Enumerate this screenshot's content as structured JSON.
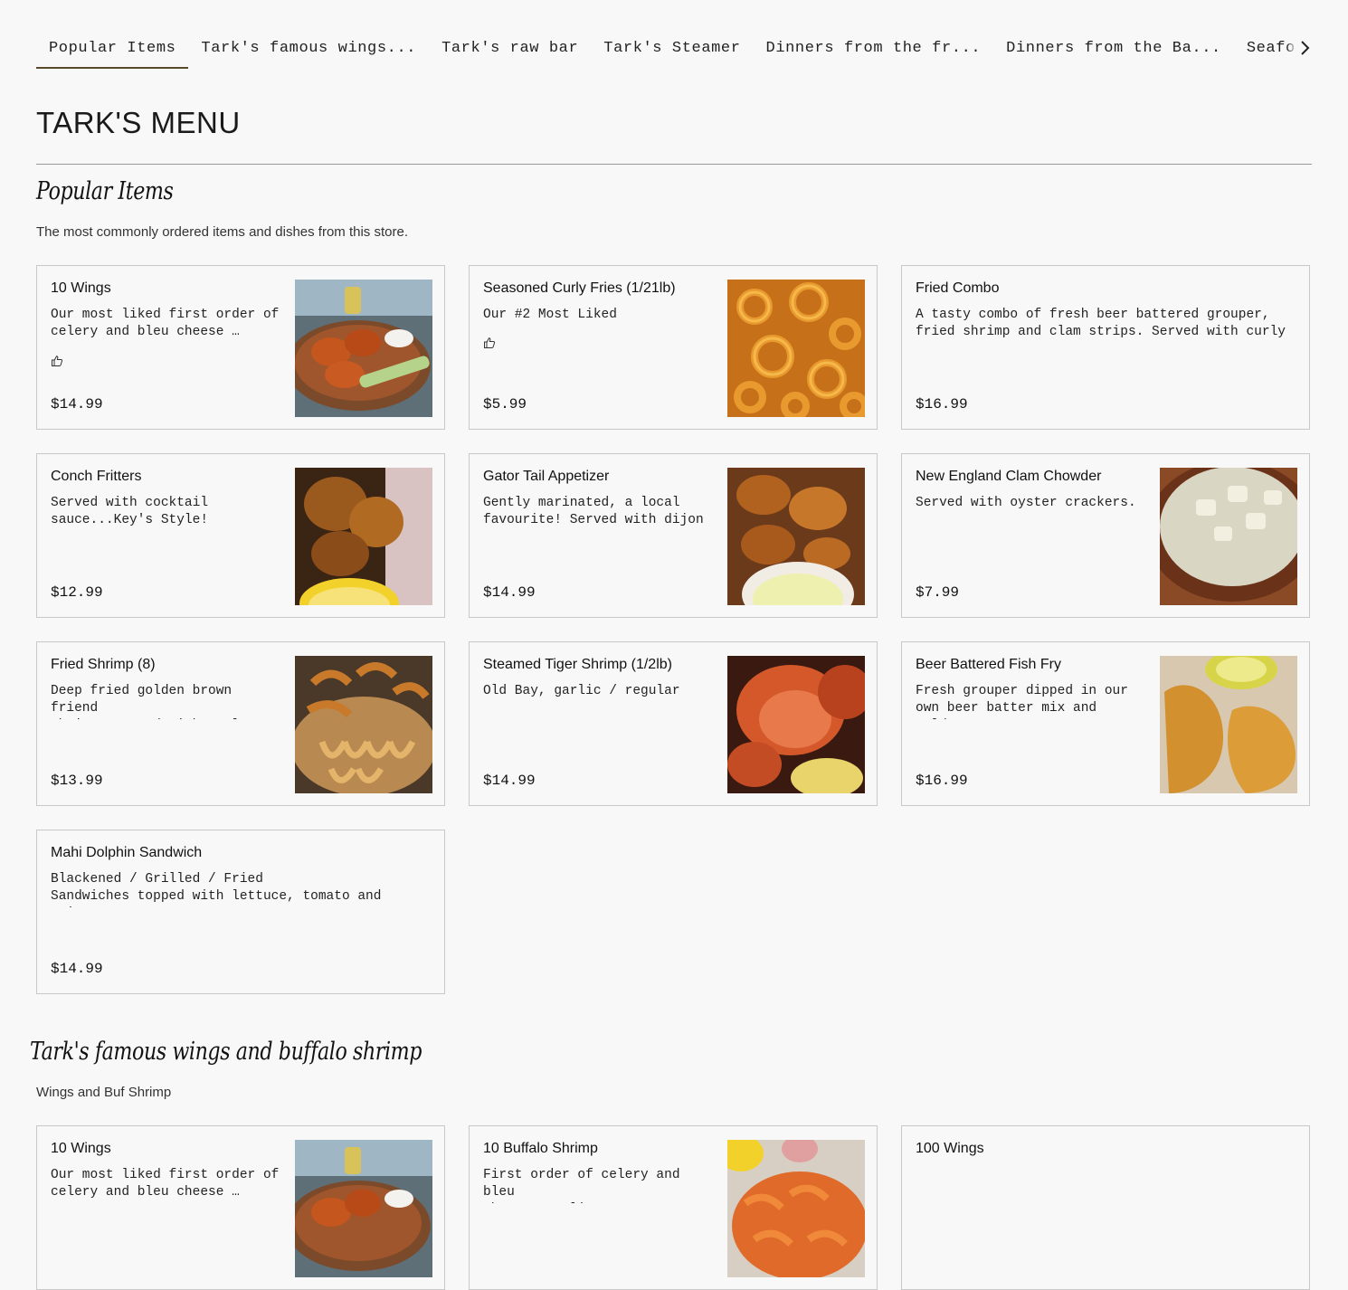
{
  "nav": {
    "tabs": [
      {
        "label": "Popular Items"
      },
      {
        "label": "Tark's famous wings..."
      },
      {
        "label": "Tark's raw bar"
      },
      {
        "label": "Tark's Steamer"
      },
      {
        "label": "Dinners from the fr..."
      },
      {
        "label": "Dinners from the Ba..."
      },
      {
        "label": "Seafood A"
      }
    ],
    "active_tab": "Popular Items",
    "scroll_icon": "chevron-right-icon"
  },
  "menu": {
    "title": "TARK'S MENU"
  },
  "popular": {
    "title": "Popular Items",
    "description": "The most commonly ordered items and dishes from this store.",
    "items": [
      {
        "name": "10 Wings",
        "description": "Our most liked first order of\ncelery and bleu cheese …",
        "price": "$14.99",
        "liked_icon": "thumbs-up-icon",
        "image": "wings-photo"
      },
      {
        "name": "Seasoned Curly Fries (1/21lb)",
        "description": "Our #2 Most Liked",
        "price": "$5.99",
        "liked_icon": "thumbs-up-icon",
        "image": "curly-fries-photo"
      },
      {
        "name": "Fried Combo",
        "description": "A tasty combo of fresh beer battered grouper,\nfried shrimp and clam strips. Served with curly …",
        "price": "$16.99"
      },
      {
        "name": "Conch Fritters",
        "description": "Served with cocktail\nsauce...Key's Style!",
        "price": "$12.99",
        "image": "conch-fritters-photo"
      },
      {
        "name": "Gator Tail Appetizer",
        "description": "Gently marinated, a local\nfavourite! Served with dijon …",
        "price": "$14.99",
        "image": "gator-tail-photo"
      },
      {
        "name": "New England Clam Chowder",
        "description": "Served with oyster crackers.",
        "price": "$7.99",
        "image": "clam-chowder-photo"
      },
      {
        "name": "Fried Shrimp (8)",
        "description": "Deep fried golden brown friend\nshrimps served with curly …",
        "price": "$13.99",
        "image": "fried-shrimp-photo"
      },
      {
        "name": "Steamed Tiger Shrimp (1/2lb)",
        "description": "Old Bay, garlic / regular",
        "price": "$14.99",
        "image": "tiger-shrimp-photo"
      },
      {
        "name": "Beer Battered Fish Fry",
        "description": "Fresh grouper dipped in our\nown beer batter mix and golde…",
        "price": "$16.99",
        "image": "fish-fry-photo"
      },
      {
        "name": "Mahi Dolphin Sandwich",
        "description": "Blackened / Grilled / Fried\nSandwiches topped with lettuce, tomato and onion,…",
        "price": "$14.99"
      }
    ]
  },
  "wings": {
    "title": "Tark's famous wings and buffalo shrimp",
    "description": "Wings and Buf Shrimp",
    "items": [
      {
        "name": "10 Wings",
        "description": "Our most liked first order of\ncelery and bleu cheese …",
        "image": "wings-photo"
      },
      {
        "name": "10 Buffalo Shrimp",
        "description": "First order of celery and bleu\ncheese complimentary.",
        "image": "buffalo-shrimp-photo"
      },
      {
        "name": "100 Wings",
        "description": ""
      }
    ]
  }
}
